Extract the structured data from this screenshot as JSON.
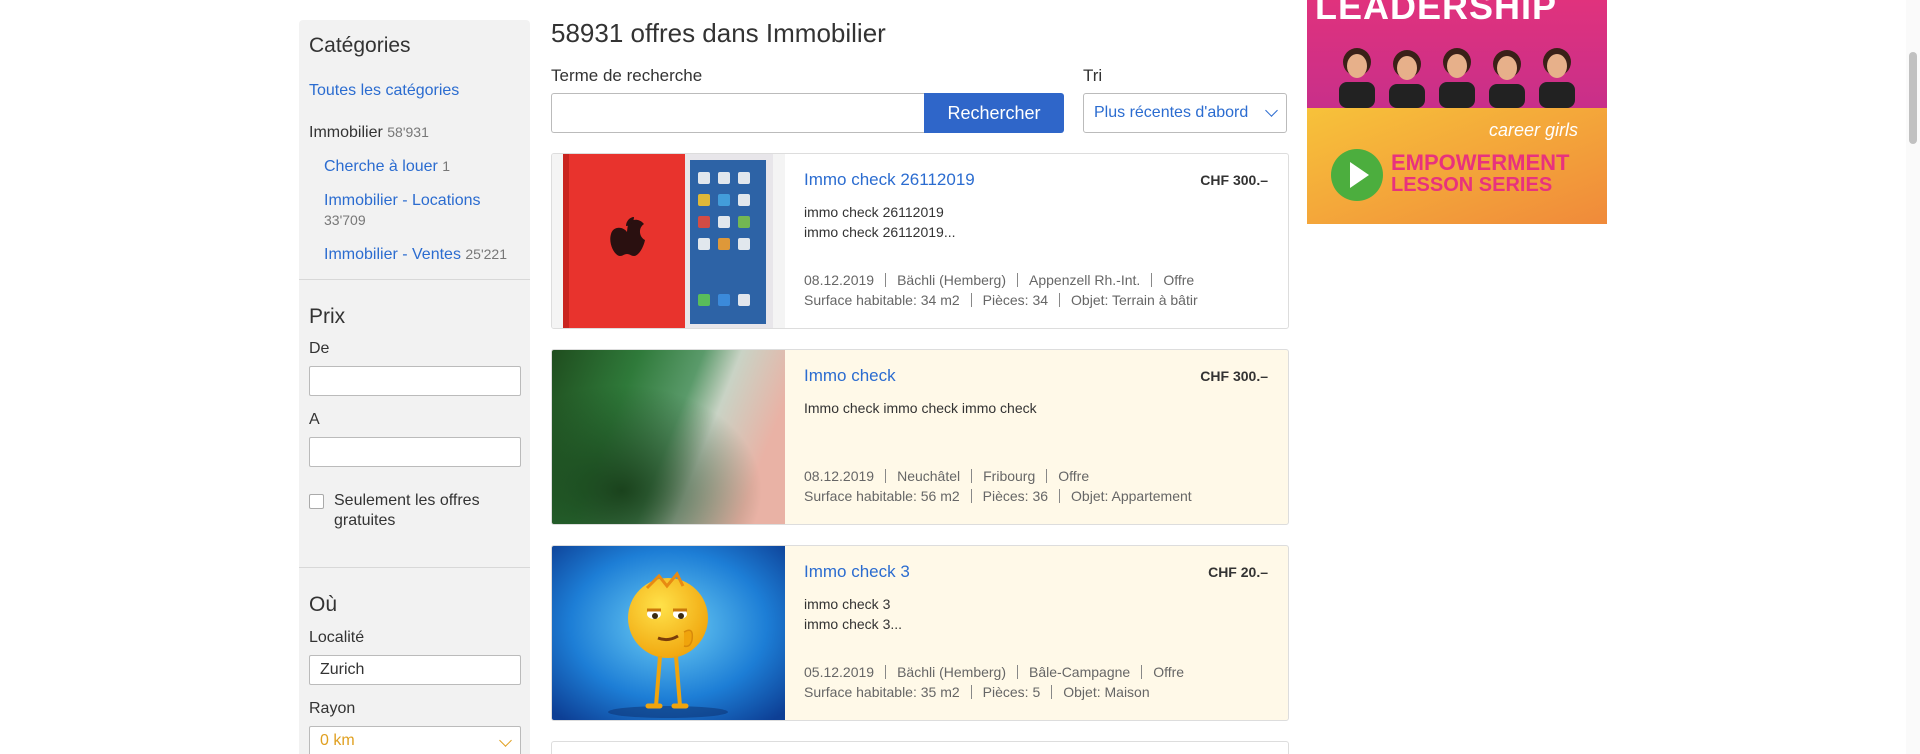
{
  "sidebar": {
    "categories_heading": "Catégories",
    "all_categories": "Toutes les catégories",
    "current_category": {
      "label": "Immobilier",
      "count": "58'931"
    },
    "subcategories": [
      {
        "label": "Cherche à louer",
        "count": "1"
      },
      {
        "label": "Immobilier - Locations",
        "count": "33'709"
      },
      {
        "label": "Immobilier - Ventes",
        "count": "25'221"
      }
    ],
    "price_heading": "Prix",
    "price_from_label": "De",
    "price_to_label": "A",
    "free_only_label_line1": "Seulement les offres",
    "free_only_label_line2": "gratuites",
    "where_heading": "Où",
    "locality_label": "Localité",
    "locality_value": "Zurich",
    "radius_label": "Rayon",
    "radius_value": "0 km"
  },
  "main": {
    "title": "58931 offres dans Immobilier",
    "search_label": "Terme de recherche",
    "search_button": "Rechercher",
    "sort_label": "Tri",
    "sort_value": "Plus récentes d'abord"
  },
  "listings": [
    {
      "title": "Immo check 26112019",
      "price": "CHF 300.–",
      "desc_line1": "immo check 26112019",
      "desc_line2": "immo check 26112019...",
      "date": "08.12.2019",
      "place": "Bächli (Hemberg)",
      "region": "Appenzell Rh.-Int.",
      "type": "Offre",
      "surface": "Surface habitable: 34 m2",
      "rooms": "Pièces: 34",
      "object": "Objet: Terrain à bâtir",
      "image": "red-tablet-image"
    },
    {
      "title": "Immo check",
      "price": "CHF 300.–",
      "desc_line1": "Immo check immo check immo check",
      "desc_line2": "",
      "date": "08.12.2019",
      "place": "Neuchâtel",
      "region": "Fribourg",
      "type": "Offre",
      "surface": "Surface habitable: 56 m2",
      "rooms": "Pièces: 36",
      "object": "Objet: Appartement",
      "image": "green-abstract-image"
    },
    {
      "title": "Immo check 3",
      "price": "CHF 20.–",
      "desc_line1": "immo check 3",
      "desc_line2": "immo check 3...",
      "date": "05.12.2019",
      "place": "Bächli (Hemberg)",
      "region": "Bâle-Campagne",
      "type": "Offre",
      "surface": "Surface habitable: 35 m2",
      "rooms": "Pièces: 5",
      "object": "Objet: Maison",
      "image": "emoji-character-image"
    }
  ],
  "ad": {
    "headline": "LEADERSHIP",
    "brand": "career girls",
    "line1": "EMPOWERMENT",
    "line2": "LESSON SERIES"
  },
  "colors": {
    "link": "#2b6cd0",
    "button": "#2f66c9",
    "sidebar_bg": "#f2f2f2",
    "listing_cream": "#fff9e8",
    "radius_value": "#e0a020"
  }
}
